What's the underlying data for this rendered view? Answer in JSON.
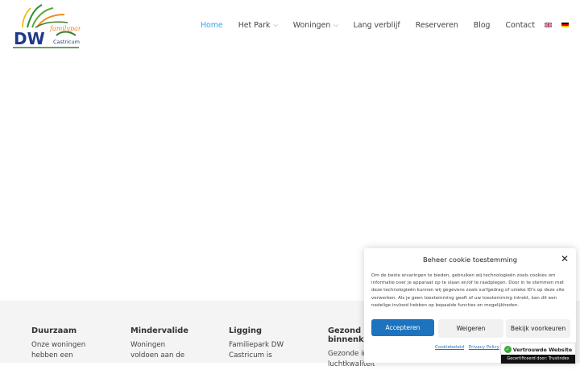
{
  "logo": {
    "alt_top": "familypark",
    "alt_main": "DW",
    "alt_sub": "Castricum"
  },
  "nav": {
    "items": [
      {
        "label": "Home",
        "active": true,
        "dropdown": false
      },
      {
        "label": "Het Park",
        "active": false,
        "dropdown": true
      },
      {
        "label": "Woningen",
        "active": false,
        "dropdown": true
      },
      {
        "label": "Lang verblijf",
        "active": false,
        "dropdown": false
      },
      {
        "label": "Reserveren",
        "active": false,
        "dropdown": false
      },
      {
        "label": "Blog",
        "active": false,
        "dropdown": false
      },
      {
        "label": "Contact",
        "active": false,
        "dropdown": false
      }
    ],
    "flags": [
      "english-flag-icon",
      "german-flag-icon"
    ],
    "active_color": "#2ea3f2"
  },
  "footer": {
    "columns": [
      {
        "title": "Duurzaam",
        "lines": [
          "Onze woningen",
          "hebben een"
        ]
      },
      {
        "title": "Mindervalide",
        "lines": [
          "Woningen",
          "voldoen aan de"
        ]
      },
      {
        "title": "Ligging",
        "lines": [
          "Familiepark DW",
          "Castricum is"
        ]
      },
      {
        "title": "Gezond binnenklim",
        "lines": [
          "Gezonde int",
          "luchtkwaliteit"
        ]
      }
    ]
  },
  "cookie": {
    "title": "Beheer cookie toestemming",
    "text": "Om de beste ervaringen te bieden, gebruiken wij technologieën zoals cookies om informatie over je apparaat op te slaan en/of te raadplegen. Door in te stemmen met deze technologieën kunnen wij gegevens zoals surfgedrag of unieke ID's op deze site verwerken. Als je geen toestemming geeft of uw toestemming intrekt, kan dit een nadelige invloed hebben op bepaalde functies en mogelijkheden.",
    "accept_label": "Accepteren",
    "deny_label": "Weigeren",
    "prefs_label": "Bekijk voorkeuren",
    "links": [
      "Cookiebeleid",
      "Privacy Policy"
    ],
    "accent": "#1e73be"
  },
  "trust": {
    "title": "Vertrouwde Website",
    "subtitle": "Gecertificeerd door: Trustindex"
  }
}
